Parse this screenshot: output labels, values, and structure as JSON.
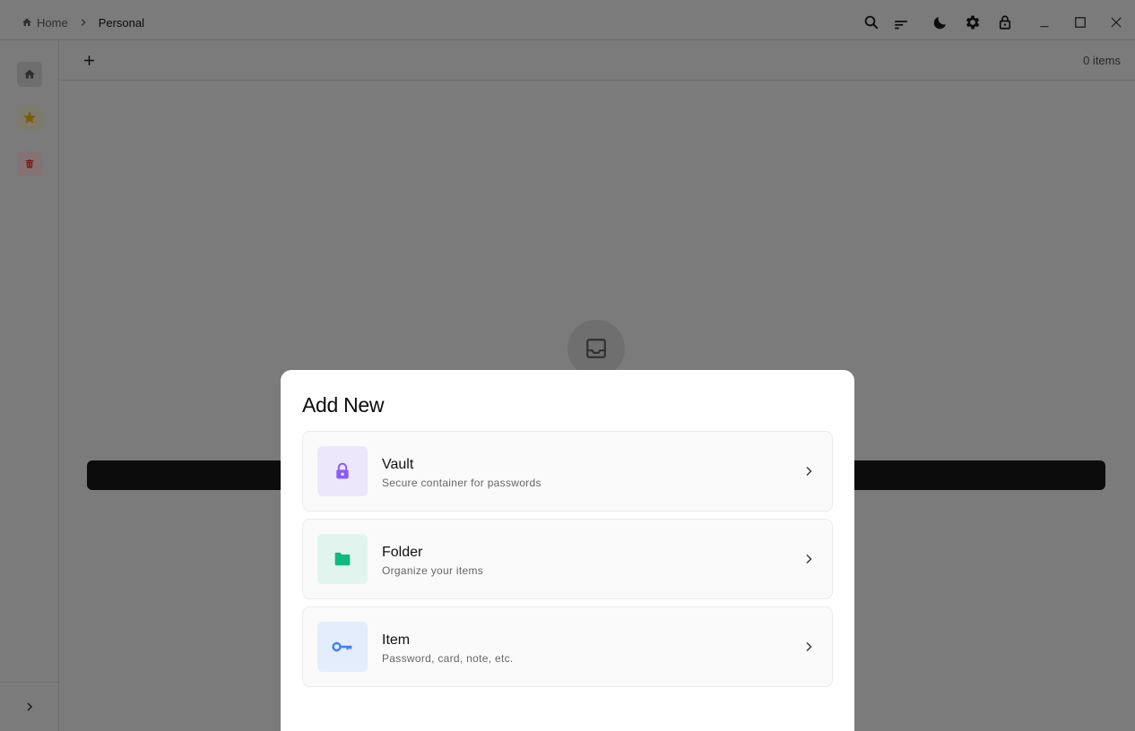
{
  "breadcrumb": {
    "home_label": "Home",
    "current_label": "Personal"
  },
  "toolbar": {
    "add_label": "+",
    "items_count": "0 items"
  },
  "modal": {
    "title": "Add New",
    "options": [
      {
        "title": "Vault",
        "subtitle": "Secure container for passwords",
        "icon": "lock-icon",
        "accent": "#8b5cf6",
        "icon_bg": "#ede7fb"
      },
      {
        "title": "Folder",
        "subtitle": "Organize your items",
        "icon": "folder-icon",
        "accent": "#10b981",
        "icon_bg": "#e1f5ee"
      },
      {
        "title": "Item",
        "subtitle": "Password, card, note, etc.",
        "icon": "key-icon",
        "accent": "#3b82f6",
        "icon_bg": "#e4edfb"
      }
    ]
  },
  "colors": {
    "overlay": "#7b7b7b",
    "favorites_accent": "#f0a500",
    "trash_accent": "#dc2626"
  }
}
